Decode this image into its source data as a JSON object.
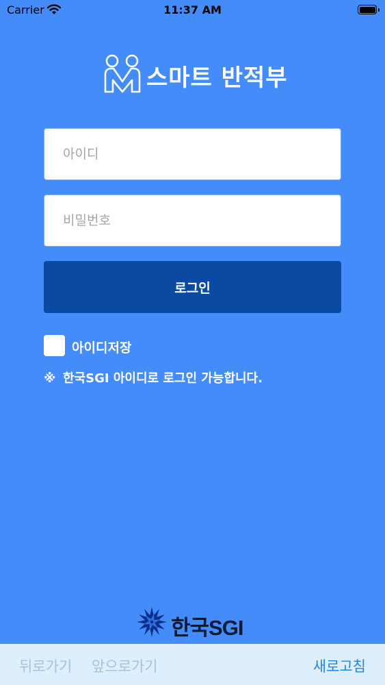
{
  "status_bar": {
    "carrier": "Carrier",
    "time": "11:37 AM"
  },
  "header": {
    "title": "스마트 반적부"
  },
  "login_form": {
    "user_id_placeholder": "아이디",
    "password_placeholder": "비밀번호",
    "login_label": "로그인",
    "remember_id_label": "아이디저장"
  },
  "notice": {
    "mark": "※",
    "text": "한국SGI 아이디로 로그인 가능합니다."
  },
  "footer": {
    "logo_text": "한국SGI"
  },
  "bottom_bar": {
    "back_label": "뒤로가기",
    "forward_label": "앞으로가기",
    "refresh_label": "새로고침"
  },
  "colors": {
    "background": "#458cfb",
    "login_button": "#0a4aa3",
    "bottom_bar": "#ddeefc",
    "refresh_text": "#1f86e6",
    "disabled_nav_text": "#a9c1d9"
  },
  "icons": [
    "wifi-icon",
    "battery-icon",
    "app-logo-icon",
    "sgi-emblem-icon"
  ]
}
